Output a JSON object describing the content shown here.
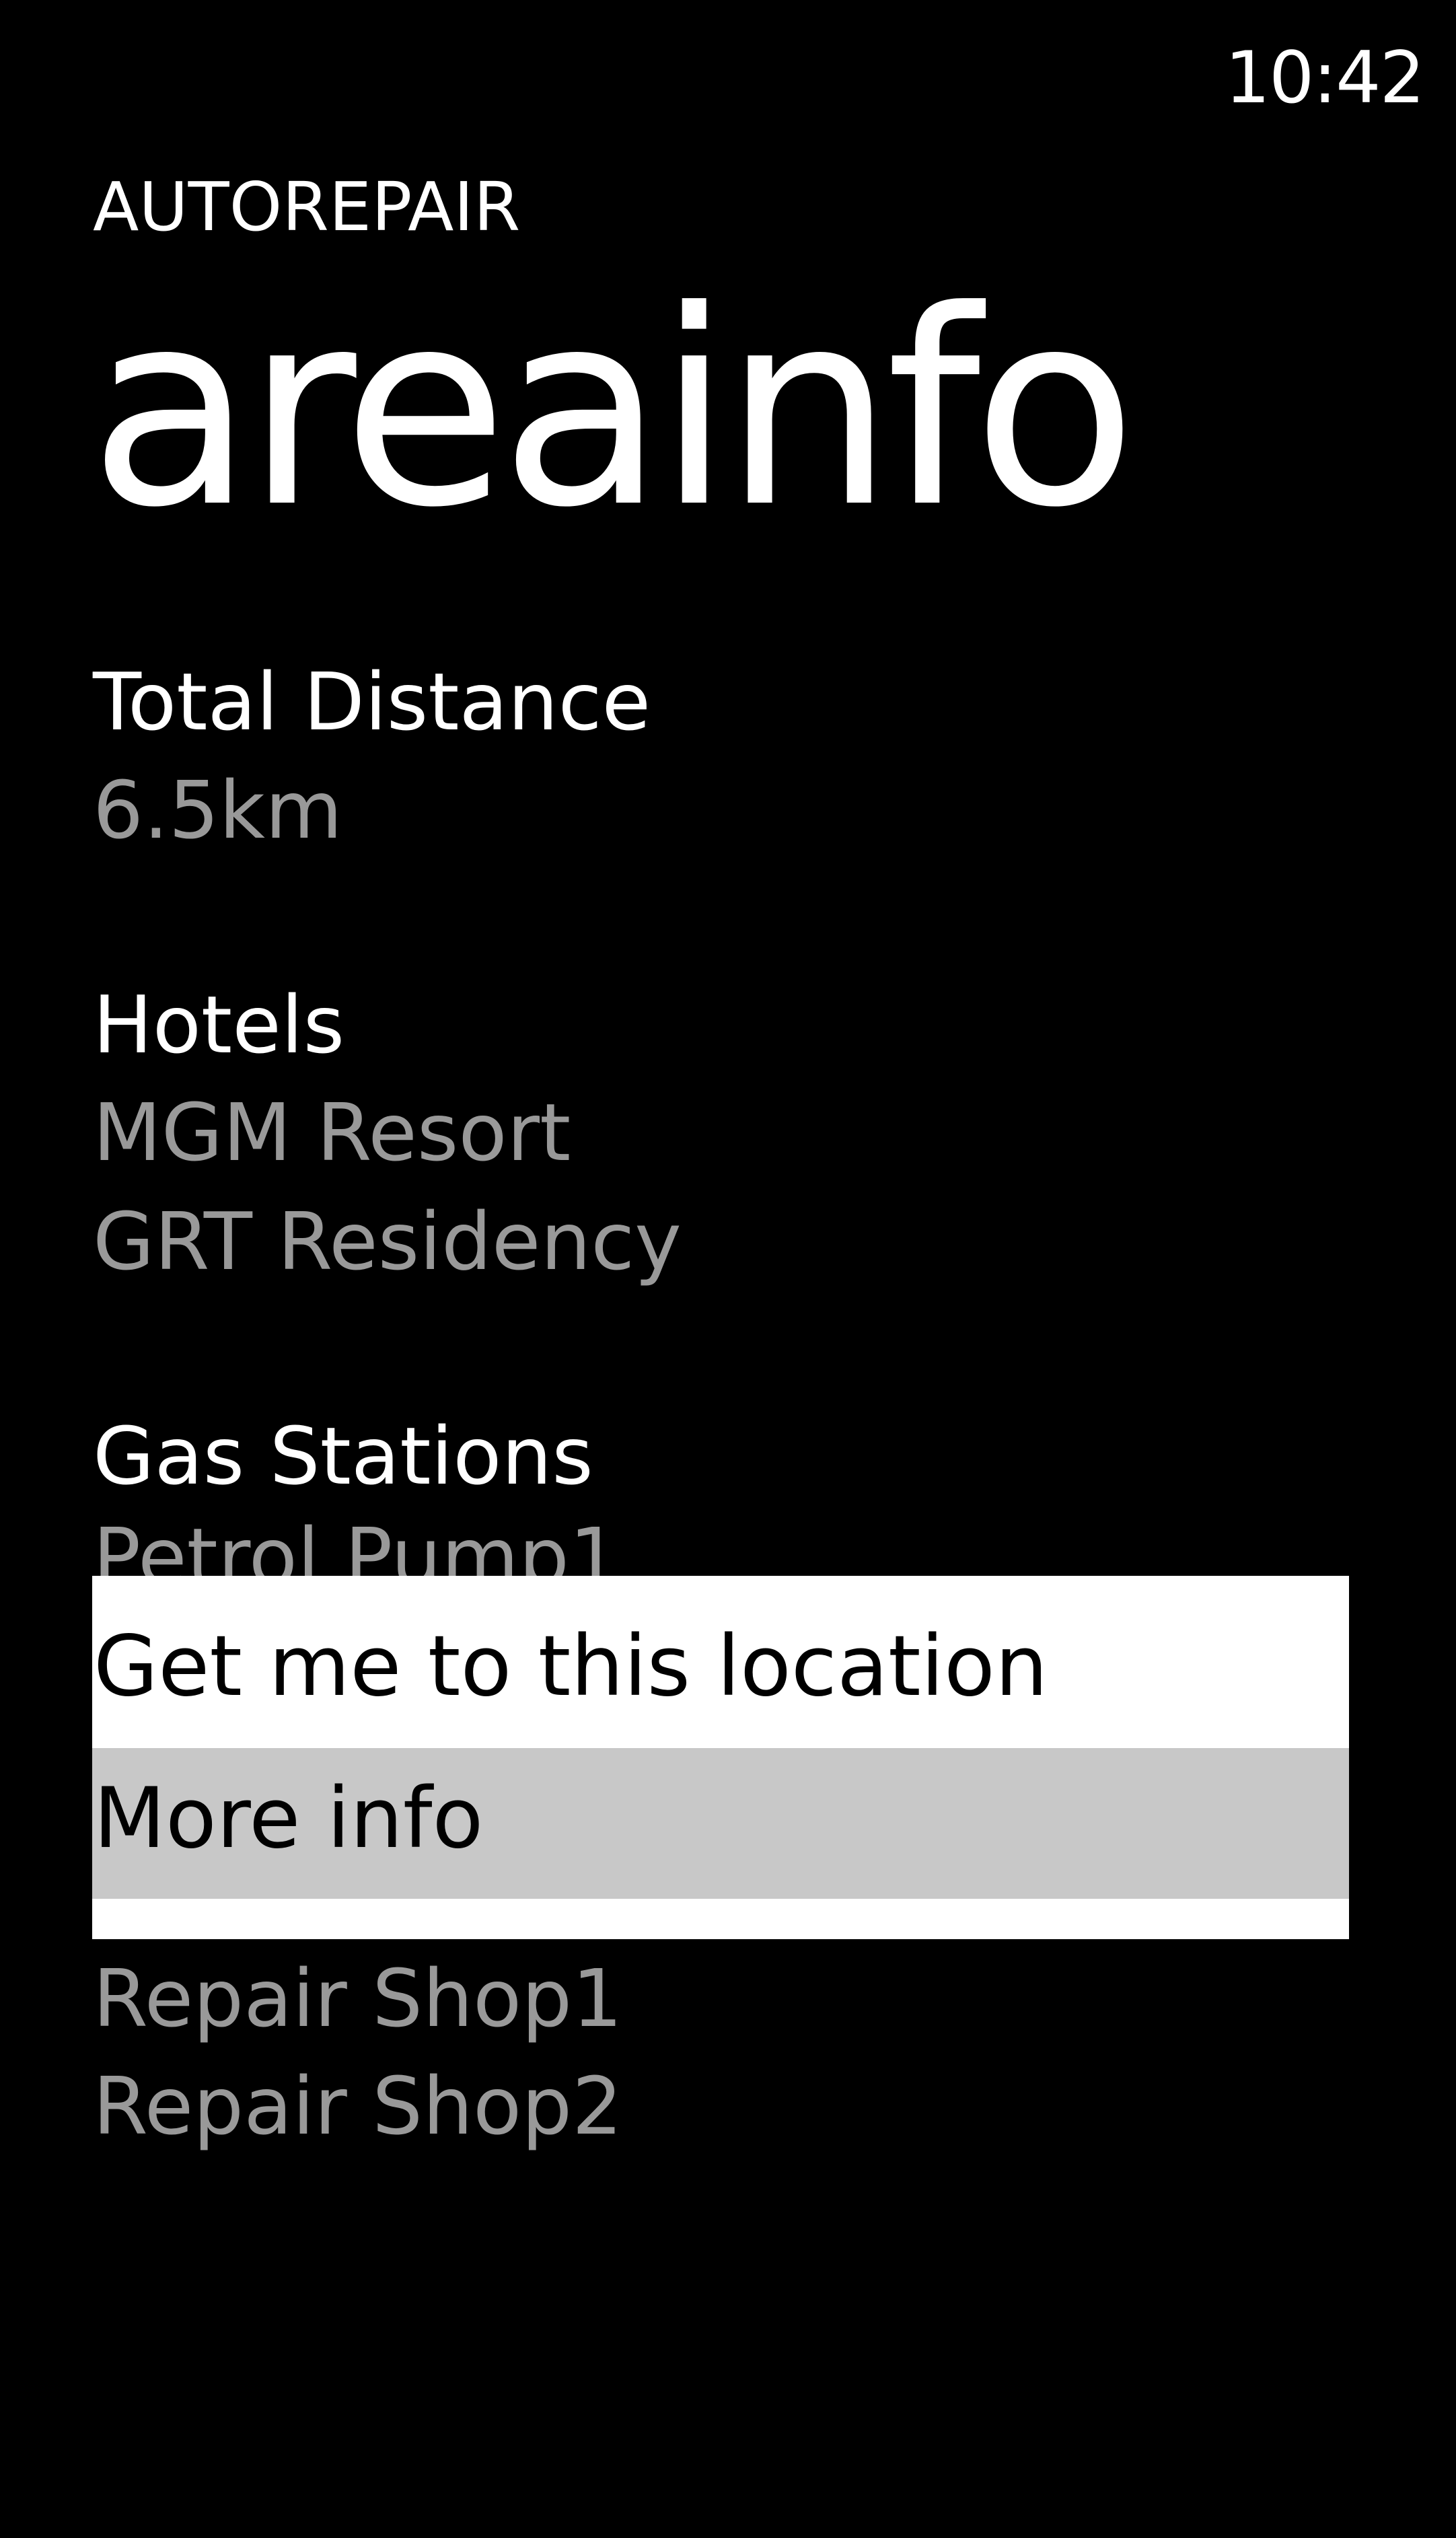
{
  "status_bar": {
    "time": "10:42"
  },
  "header": {
    "app_title": "AUTOREPAIR",
    "page_title": "areainfo"
  },
  "sections": {
    "distance": {
      "heading": "Total Distance",
      "value": "6.5km"
    },
    "hotels": {
      "heading": "Hotels",
      "items": [
        "MGM Resort",
        "GRT Residency"
      ]
    },
    "gas_stations": {
      "heading": "Gas Stations",
      "items": [
        "Petrol Pump1"
      ]
    },
    "repair_shops": {
      "items": [
        "Repair Shop1",
        "Repair Shop2"
      ]
    }
  },
  "context_menu": {
    "items": [
      "Get me to this location",
      "More info"
    ],
    "highlighted_index": 1
  },
  "colors": {
    "background": "#000000",
    "primary_text": "#ffffff",
    "secondary_text": "#999999",
    "menu_background": "#ffffff",
    "menu_highlight": "#c8c8c8"
  }
}
